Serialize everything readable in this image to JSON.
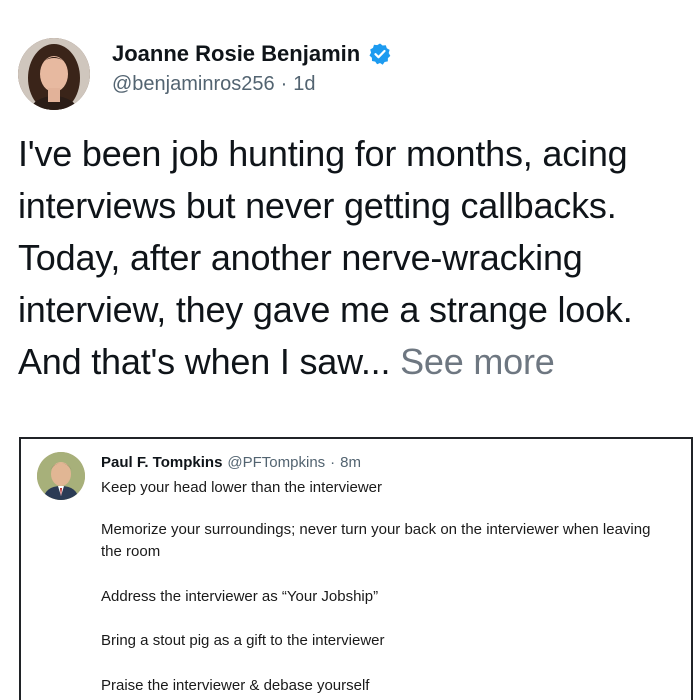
{
  "author": {
    "display_name": "Joanne Rosie Benjamin",
    "handle": "@benjaminros256",
    "separator": "·",
    "time": "1d",
    "verified": true
  },
  "post": {
    "text": "I've been job hunting for months, acing interviews but never getting callbacks. Today, after another nerve-wracking interview, they gave me a strange look. And that's when I saw...",
    "see_more": "See more"
  },
  "embedded_tweet": {
    "display_name": "Paul F. Tompkins",
    "handle": "@PFTompkins",
    "separator": "·",
    "time": "8m",
    "lines": [
      "Keep your head lower than the interviewer",
      "Memorize your surroundings; never turn your back on the interviewer when leaving the room",
      "Address the interviewer as “Your Jobship”",
      "Bring a stout pig as a gift to the interviewer",
      "Praise the interviewer & debase yourself"
    ]
  },
  "colors": {
    "verified_badge": "#1d9bf0",
    "secondary_text": "#536471",
    "see_more": "#6e7781"
  }
}
